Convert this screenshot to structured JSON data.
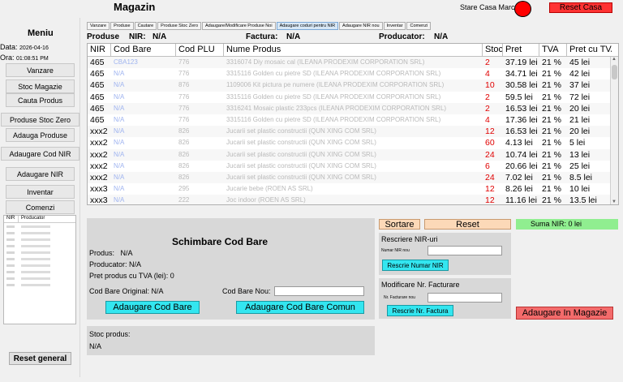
{
  "app": {
    "title": "Magazin",
    "stare_label": "Stare Casa Marcat:",
    "stare_color": "#ff0000",
    "reset_casa": "Reset Casa"
  },
  "sidebar": {
    "title": "Meniu",
    "data_label": "Data:",
    "data_value": "2026-04-16",
    "ora_label": "Ora:",
    "ora_value": "01:08:51 PM",
    "buttons": [
      "Vanzare",
      "Stoc Magazie",
      "Cauta Produs",
      "Produse Stoc Zero",
      "Adauga Produse",
      "Adaugare Cod NIR",
      "Adaugare NIR",
      "Inventar",
      "Comenzi"
    ],
    "nir_headers": [
      "NIR",
      "Producator"
    ],
    "reset_general": "Reset general"
  },
  "tabs": [
    "Vanzare",
    "Produse",
    "Cautare",
    "Produse Stoc Zero",
    "Adaugare/Modificare Produse Noi",
    "Adaugare coduri pentru NIR",
    "Adaugare NIR nou",
    "Inventar",
    "Comenzi"
  ],
  "active_tab": "Adaugare coduri pentru NIR",
  "infobar": {
    "produse": "Produse",
    "nir_label": "NIR:",
    "nir_value": "N/A",
    "factura_label": "Factura:",
    "factura_value": "N/A",
    "producator_label": "Producator:",
    "producator_value": "N/A"
  },
  "table": {
    "headers": [
      "NIR",
      "Cod Bare",
      "Cod PLU",
      "Nume Produs",
      "Stoc",
      "Pret",
      "TVA",
      "Pret cu TVA"
    ],
    "rows": [
      [
        "465",
        "CBA123",
        "776",
        "3316074 Diy mosaic cal (ILEANA PRODEXIM CORPORATION SRL)",
        "2",
        "37.19 lei",
        "21 %",
        "45 lei"
      ],
      [
        "465",
        "N/A",
        "776",
        "3315116 Golden cu pietre SD (ILEANA PRODEXIM CORPORATION SRL)",
        "4",
        "34.71 lei",
        "21 %",
        "42 lei"
      ],
      [
        "465",
        "N/A",
        "876",
        "1109006 Kit pictura pe numere (ILEANA PRODEXIM CORPORATION SRL)",
        "10",
        "30.58 lei",
        "21 %",
        "37 lei"
      ],
      [
        "465",
        "N/A",
        "776",
        "3315116 Golden cu pietre SD (ILEANA PRODEXIM CORPORATION SRL)",
        "2",
        "59.5 lei",
        "21 %",
        "72 lei"
      ],
      [
        "465",
        "N/A",
        "776",
        "3316241 Mosaic plastic 233pcs (ILEANA PRODEXIM CORPORATION SRL)",
        "2",
        "16.53 lei",
        "21 %",
        "20 lei"
      ],
      [
        "465",
        "N/A",
        "776",
        "3315116 Golden cu pietre SD (ILEANA PRODEXIM CORPORATION SRL)",
        "4",
        "17.36 lei",
        "21 %",
        "21 lei"
      ],
      [
        "xxx2",
        "N/A",
        "826",
        "Jucarii set plastic constructii (QUN XING COM SRL)",
        "12",
        "16.53 lei",
        "21 %",
        "20 lei"
      ],
      [
        "xxx2",
        "N/A",
        "826",
        "Jucarii set plastic constructii (QUN XING COM SRL)",
        "60",
        "4.13 lei",
        "21 %",
        "5 lei"
      ],
      [
        "xxx2",
        "N/A",
        "826",
        "Jucarii set plastic constructii (QUN XING COM SRL)",
        "24",
        "10.74 lei",
        "21 %",
        "13 lei"
      ],
      [
        "xxx2",
        "N/A",
        "826",
        "Jucarii set plastic constructii (QUN XING COM SRL)",
        "6",
        "20.66 lei",
        "21 %",
        "25 lei"
      ],
      [
        "xxx2",
        "N/A",
        "826",
        "Jucarii set plastic constructii (QUN XING COM SRL)",
        "24",
        "7.02 lei",
        "21 %",
        "8.5 lei"
      ],
      [
        "xxx3",
        "N/A",
        "295",
        "Jucarie bebe (ROEN AS SRL)",
        "12",
        "8.26 lei",
        "21 %",
        "10 lei"
      ],
      [
        "xxx3",
        "N/A",
        "222",
        "Joc indoor (ROEN AS SRL)",
        "12",
        "11.16 lei",
        "21 %",
        "13.5 lei"
      ]
    ]
  },
  "schimbare": {
    "title": "Schimbare Cod Bare",
    "produs_label": "Produs:",
    "produs_value": "N/A",
    "producator_line": "Producator: N/A",
    "pret_line": "Pret produs cu TVA (lei):  0",
    "cod_original_line": "Cod Bare Original: N/A",
    "cod_nou_label": "Cod Bare Nou:",
    "btn_adaugare": "Adaugare Cod Bare",
    "btn_comun": "Adaugare Cod Bare Comun"
  },
  "stoc": {
    "label": "Stoc produs:",
    "value": "N/A"
  },
  "right": {
    "sortare": "Sortare",
    "reset": "Reset",
    "suma_nir": "Suma NIR:  0 lei",
    "rescriere_title": "Rescriere NIR-uri",
    "numar_nir_nou": "Numar NIR nou",
    "btn_rescrie_nir": "Rescrie Numar NIR",
    "modificare_title": "Modificare Nr. Facturare",
    "nr_factura_nou": "Nr. Facturare nou",
    "btn_rescrie_factura": "Rescrie Nr. Factura",
    "btn_magazie": "Adaugare In Magazie"
  }
}
